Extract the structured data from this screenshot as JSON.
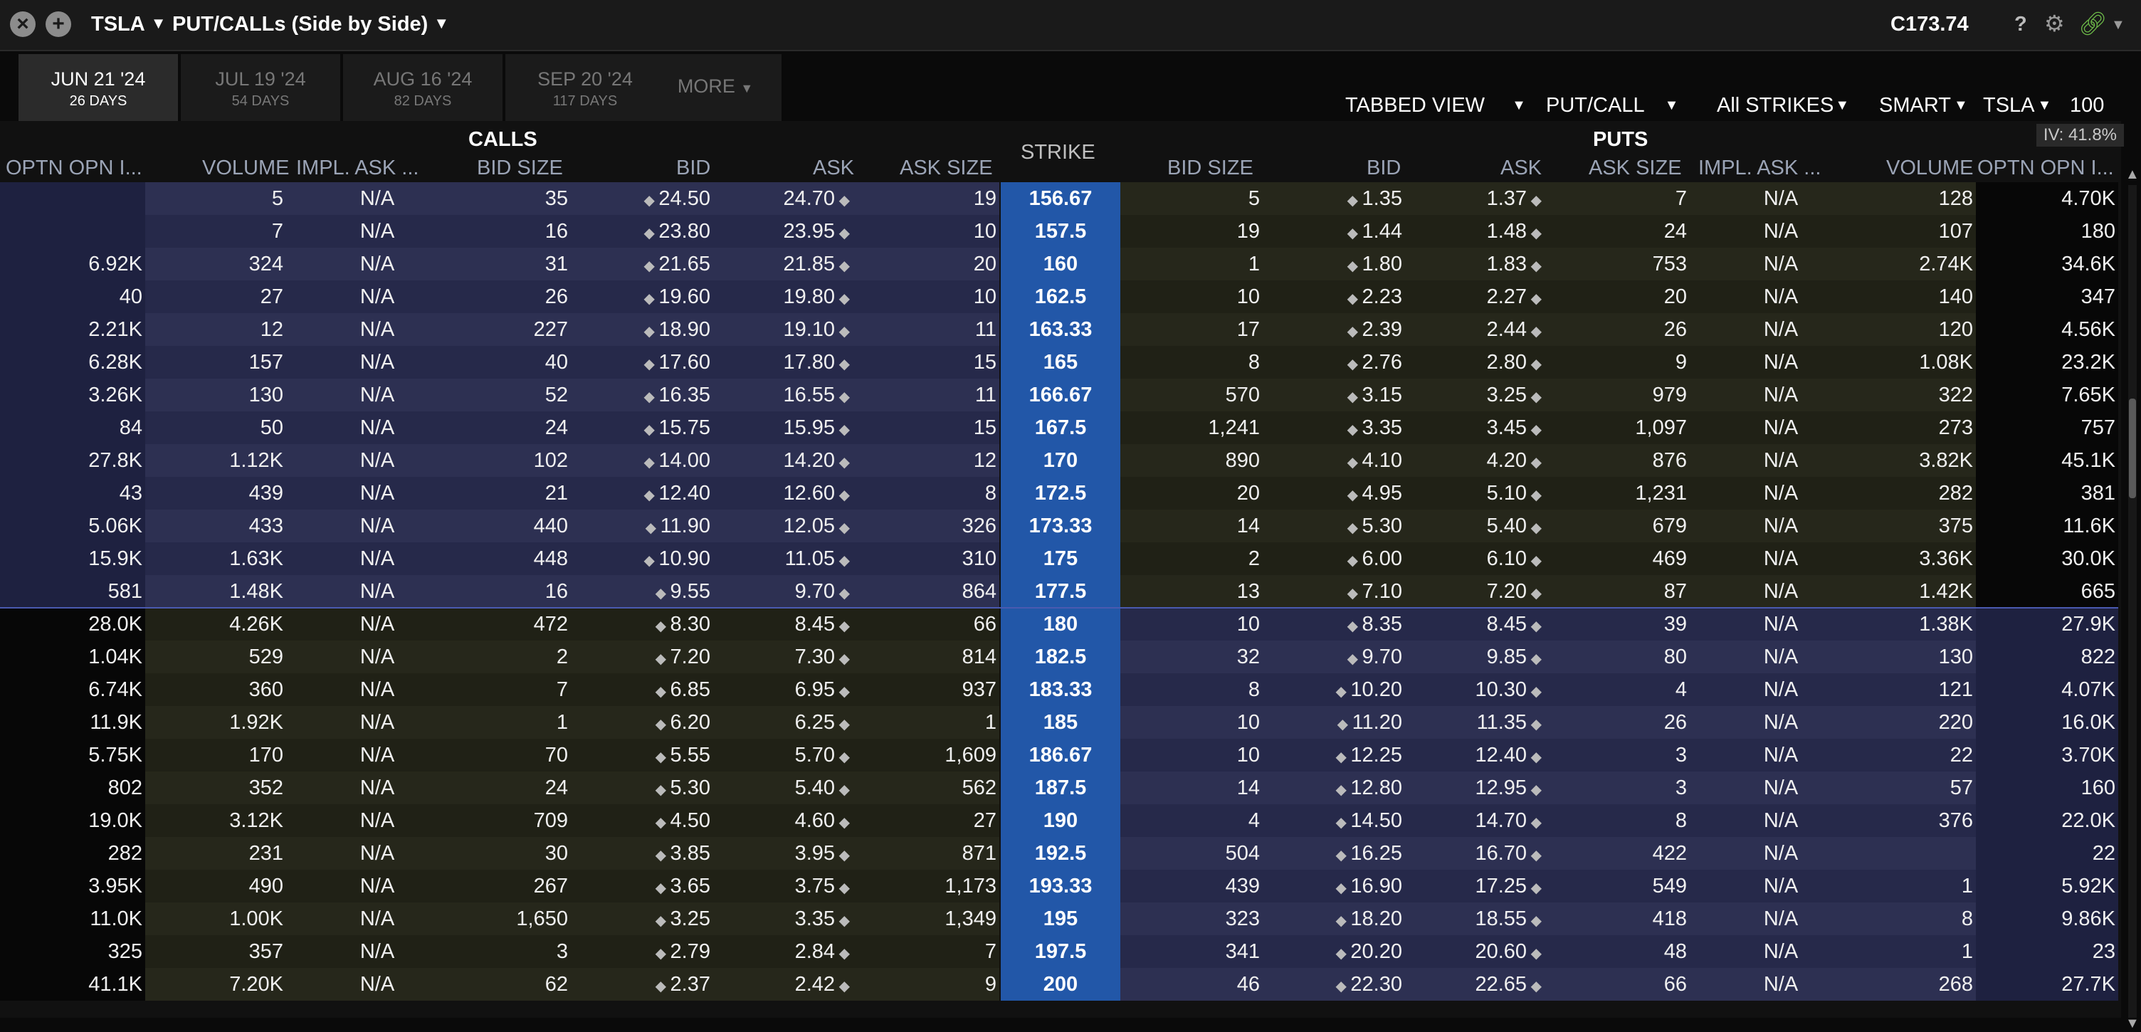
{
  "window": {
    "symbol": "TSLA",
    "title": "PUT/CALLs (Side by Side)",
    "price": "C173.74",
    "help": "?"
  },
  "icons": {
    "close": "close-icon",
    "add": "add-icon",
    "settings": "gear-icon",
    "link": "link-icon"
  },
  "tabs": [
    {
      "date": "JUN 21 '24",
      "days": "26 DAYS"
    },
    {
      "date": "JUL 19 '24",
      "days": "54 DAYS"
    },
    {
      "date": "AUG 16 '24",
      "days": "82 DAYS"
    },
    {
      "date": "SEP 20 '24",
      "days": "117 DAYS"
    },
    {
      "date": "MORE",
      "days": ""
    }
  ],
  "controls": {
    "view": "TABBED VIEW",
    "putcall": "PUT/CALL",
    "strikes": "All STRIKES",
    "exchange": "SMART",
    "underlying": "TSLA",
    "quantity": "100",
    "iv": "IV: 41.8%"
  },
  "sections": {
    "calls": "CALLS",
    "puts": "PUTS",
    "strike": "STRIKE"
  },
  "headers": {
    "calls": [
      "OPTN OPN I...",
      "VOLUME",
      "IMPL. ASK ...",
      "BID SIZE",
      "BID",
      "ASK",
      "ASK SIZE"
    ],
    "puts": [
      "BID SIZE",
      "BID",
      "ASK",
      "ASK SIZE",
      "IMPL. ASK ...",
      "VOLUME",
      "OPTN OPN I..."
    ]
  },
  "rows": [
    {
      "c_oi": "",
      "c_vol": "5",
      "c_iv": "N/A",
      "c_bs": "35",
      "c_bid": "24.50",
      "c_ask": "24.70",
      "c_as": "19",
      "strike": "156.67",
      "p_bs": "5",
      "p_bid": "1.35",
      "p_ask": "1.37",
      "p_as": "7",
      "p_iv": "N/A",
      "p_vol": "128",
      "p_oi": "4.70K",
      "itm": "call"
    },
    {
      "c_oi": "",
      "c_vol": "7",
      "c_iv": "N/A",
      "c_bs": "16",
      "c_bid": "23.80",
      "c_ask": "23.95",
      "c_as": "10",
      "strike": "157.5",
      "p_bs": "19",
      "p_bid": "1.44",
      "p_ask": "1.48",
      "p_as": "24",
      "p_iv": "N/A",
      "p_vol": "107",
      "p_oi": "180",
      "itm": "call"
    },
    {
      "c_oi": "6.92K",
      "c_vol": "324",
      "c_iv": "N/A",
      "c_bs": "31",
      "c_bid": "21.65",
      "c_ask": "21.85",
      "c_as": "20",
      "strike": "160",
      "p_bs": "1",
      "p_bid": "1.80",
      "p_ask": "1.83",
      "p_as": "753",
      "p_iv": "N/A",
      "p_vol": "2.74K",
      "p_oi": "34.6K",
      "itm": "call"
    },
    {
      "c_oi": "40",
      "c_vol": "27",
      "c_iv": "N/A",
      "c_bs": "26",
      "c_bid": "19.60",
      "c_ask": "19.80",
      "c_as": "10",
      "strike": "162.5",
      "p_bs": "10",
      "p_bid": "2.23",
      "p_ask": "2.27",
      "p_as": "20",
      "p_iv": "N/A",
      "p_vol": "140",
      "p_oi": "347",
      "itm": "call"
    },
    {
      "c_oi": "2.21K",
      "c_vol": "12",
      "c_iv": "N/A",
      "c_bs": "227",
      "c_bid": "18.90",
      "c_ask": "19.10",
      "c_as": "11",
      "strike": "163.33",
      "p_bs": "17",
      "p_bid": "2.39",
      "p_ask": "2.44",
      "p_as": "26",
      "p_iv": "N/A",
      "p_vol": "120",
      "p_oi": "4.56K",
      "itm": "call"
    },
    {
      "c_oi": "6.28K",
      "c_vol": "157",
      "c_iv": "N/A",
      "c_bs": "40",
      "c_bid": "17.60",
      "c_ask": "17.80",
      "c_as": "15",
      "strike": "165",
      "p_bs": "8",
      "p_bid": "2.76",
      "p_ask": "2.80",
      "p_as": "9",
      "p_iv": "N/A",
      "p_vol": "1.08K",
      "p_oi": "23.2K",
      "itm": "call"
    },
    {
      "c_oi": "3.26K",
      "c_vol": "130",
      "c_iv": "N/A",
      "c_bs": "52",
      "c_bid": "16.35",
      "c_ask": "16.55",
      "c_as": "11",
      "strike": "166.67",
      "p_bs": "570",
      "p_bid": "3.15",
      "p_ask": "3.25",
      "p_as": "979",
      "p_iv": "N/A",
      "p_vol": "322",
      "p_oi": "7.65K",
      "itm": "call"
    },
    {
      "c_oi": "84",
      "c_vol": "50",
      "c_iv": "N/A",
      "c_bs": "24",
      "c_bid": "15.75",
      "c_ask": "15.95",
      "c_as": "15",
      "strike": "167.5",
      "p_bs": "1,241",
      "p_bid": "3.35",
      "p_ask": "3.45",
      "p_as": "1,097",
      "p_iv": "N/A",
      "p_vol": "273",
      "p_oi": "757",
      "itm": "call"
    },
    {
      "c_oi": "27.8K",
      "c_vol": "1.12K",
      "c_iv": "N/A",
      "c_bs": "102",
      "c_bid": "14.00",
      "c_ask": "14.20",
      "c_as": "12",
      "strike": "170",
      "p_bs": "890",
      "p_bid": "4.10",
      "p_ask": "4.20",
      "p_as": "876",
      "p_iv": "N/A",
      "p_vol": "3.82K",
      "p_oi": "45.1K",
      "itm": "call"
    },
    {
      "c_oi": "43",
      "c_vol": "439",
      "c_iv": "N/A",
      "c_bs": "21",
      "c_bid": "12.40",
      "c_ask": "12.60",
      "c_as": "8",
      "strike": "172.5",
      "p_bs": "20",
      "p_bid": "4.95",
      "p_ask": "5.10",
      "p_as": "1,231",
      "p_iv": "N/A",
      "p_vol": "282",
      "p_oi": "381",
      "itm": "call"
    },
    {
      "c_oi": "5.06K",
      "c_vol": "433",
      "c_iv": "N/A",
      "c_bs": "440",
      "c_bid": "11.90",
      "c_ask": "12.05",
      "c_as": "326",
      "strike": "173.33",
      "p_bs": "14",
      "p_bid": "5.30",
      "p_ask": "5.40",
      "p_as": "679",
      "p_iv": "N/A",
      "p_vol": "375",
      "p_oi": "11.6K",
      "itm": "call"
    },
    {
      "c_oi": "15.9K",
      "c_vol": "1.63K",
      "c_iv": "N/A",
      "c_bs": "448",
      "c_bid": "10.90",
      "c_ask": "11.05",
      "c_as": "310",
      "strike": "175",
      "p_bs": "2",
      "p_bid": "6.00",
      "p_ask": "6.10",
      "p_as": "469",
      "p_iv": "N/A",
      "p_vol": "3.36K",
      "p_oi": "30.0K",
      "itm": "call"
    },
    {
      "c_oi": "581",
      "c_vol": "1.48K",
      "c_iv": "N/A",
      "c_bs": "16",
      "c_bid": "9.55",
      "c_ask": "9.70",
      "c_as": "864",
      "strike": "177.5",
      "p_bs": "13",
      "p_bid": "7.10",
      "p_ask": "7.20",
      "p_as": "87",
      "p_iv": "N/A",
      "p_vol": "1.42K",
      "p_oi": "665",
      "itm": "call"
    },
    {
      "c_oi": "28.0K",
      "c_vol": "4.26K",
      "c_iv": "N/A",
      "c_bs": "472",
      "c_bid": "8.30",
      "c_ask": "8.45",
      "c_as": "66",
      "strike": "180",
      "p_bs": "10",
      "p_bid": "8.35",
      "p_ask": "8.45",
      "p_as": "39",
      "p_iv": "N/A",
      "p_vol": "1.38K",
      "p_oi": "27.9K",
      "itm": "put"
    },
    {
      "c_oi": "1.04K",
      "c_vol": "529",
      "c_iv": "N/A",
      "c_bs": "2",
      "c_bid": "7.20",
      "c_ask": "7.30",
      "c_as": "814",
      "strike": "182.5",
      "p_bs": "32",
      "p_bid": "9.70",
      "p_ask": "9.85",
      "p_as": "80",
      "p_iv": "N/A",
      "p_vol": "130",
      "p_oi": "822",
      "itm": "put"
    },
    {
      "c_oi": "6.74K",
      "c_vol": "360",
      "c_iv": "N/A",
      "c_bs": "7",
      "c_bid": "6.85",
      "c_ask": "6.95",
      "c_as": "937",
      "strike": "183.33",
      "p_bs": "8",
      "p_bid": "10.20",
      "p_ask": "10.30",
      "p_as": "4",
      "p_iv": "N/A",
      "p_vol": "121",
      "p_oi": "4.07K",
      "itm": "put"
    },
    {
      "c_oi": "11.9K",
      "c_vol": "1.92K",
      "c_iv": "N/A",
      "c_bs": "1",
      "c_bid": "6.20",
      "c_ask": "6.25",
      "c_as": "1",
      "strike": "185",
      "p_bs": "10",
      "p_bid": "11.20",
      "p_ask": "11.35",
      "p_as": "26",
      "p_iv": "N/A",
      "p_vol": "220",
      "p_oi": "16.0K",
      "itm": "put"
    },
    {
      "c_oi": "5.75K",
      "c_vol": "170",
      "c_iv": "N/A",
      "c_bs": "70",
      "c_bid": "5.55",
      "c_ask": "5.70",
      "c_as": "1,609",
      "strike": "186.67",
      "p_bs": "10",
      "p_bid": "12.25",
      "p_ask": "12.40",
      "p_as": "3",
      "p_iv": "N/A",
      "p_vol": "22",
      "p_oi": "3.70K",
      "itm": "put"
    },
    {
      "c_oi": "802",
      "c_vol": "352",
      "c_iv": "N/A",
      "c_bs": "24",
      "c_bid": "5.30",
      "c_ask": "5.40",
      "c_as": "562",
      "strike": "187.5",
      "p_bs": "14",
      "p_bid": "12.80",
      "p_ask": "12.95",
      "p_as": "3",
      "p_iv": "N/A",
      "p_vol": "57",
      "p_oi": "160",
      "itm": "put"
    },
    {
      "c_oi": "19.0K",
      "c_vol": "3.12K",
      "c_iv": "N/A",
      "c_bs": "709",
      "c_bid": "4.50",
      "c_ask": "4.60",
      "c_as": "27",
      "strike": "190",
      "p_bs": "4",
      "p_bid": "14.50",
      "p_ask": "14.70",
      "p_as": "8",
      "p_iv": "N/A",
      "p_vol": "376",
      "p_oi": "22.0K",
      "itm": "put"
    },
    {
      "c_oi": "282",
      "c_vol": "231",
      "c_iv": "N/A",
      "c_bs": "30",
      "c_bid": "3.85",
      "c_ask": "3.95",
      "c_as": "871",
      "strike": "192.5",
      "p_bs": "504",
      "p_bid": "16.25",
      "p_ask": "16.70",
      "p_as": "422",
      "p_iv": "N/A",
      "p_vol": "",
      "p_oi": "22",
      "itm": "put"
    },
    {
      "c_oi": "3.95K",
      "c_vol": "490",
      "c_iv": "N/A",
      "c_bs": "267",
      "c_bid": "3.65",
      "c_ask": "3.75",
      "c_as": "1,173",
      "strike": "193.33",
      "p_bs": "439",
      "p_bid": "16.90",
      "p_ask": "17.25",
      "p_as": "549",
      "p_iv": "N/A",
      "p_vol": "1",
      "p_oi": "5.92K",
      "itm": "put"
    },
    {
      "c_oi": "11.0K",
      "c_vol": "1.00K",
      "c_iv": "N/A",
      "c_bs": "1,650",
      "c_bid": "3.25",
      "c_ask": "3.35",
      "c_as": "1,349",
      "strike": "195",
      "p_bs": "323",
      "p_bid": "18.20",
      "p_ask": "18.55",
      "p_as": "418",
      "p_iv": "N/A",
      "p_vol": "8",
      "p_oi": "9.86K",
      "itm": "put"
    },
    {
      "c_oi": "325",
      "c_vol": "357",
      "c_iv": "N/A",
      "c_bs": "3",
      "c_bid": "2.79",
      "c_ask": "2.84",
      "c_as": "7",
      "strike": "197.5",
      "p_bs": "341",
      "p_bid": "20.20",
      "p_ask": "20.60",
      "p_as": "48",
      "p_iv": "N/A",
      "p_vol": "1",
      "p_oi": "23",
      "itm": "put"
    },
    {
      "c_oi": "41.1K",
      "c_vol": "7.20K",
      "c_iv": "N/A",
      "c_bs": "62",
      "c_bid": "2.37",
      "c_ask": "2.42",
      "c_as": "9",
      "strike": "200",
      "p_bs": "46",
      "p_bid": "22.30",
      "p_ask": "22.65",
      "p_as": "66",
      "p_iv": "N/A",
      "p_vol": "268",
      "p_oi": "27.7K",
      "itm": "put"
    }
  ],
  "colors": {
    "itm_call_a": "#2d3052",
    "itm_call_b": "#26294a",
    "itm_call_oi": "#1e2140",
    "otm_a": "#26271b",
    "otm_b": "#202116",
    "otm_oi": "#070707",
    "strike": "#2257a8"
  }
}
